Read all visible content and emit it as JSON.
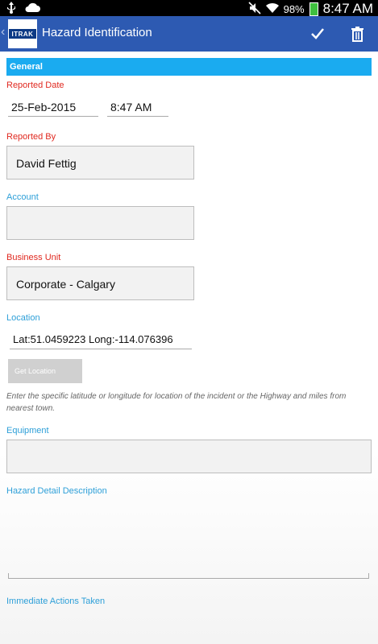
{
  "status_bar": {
    "battery": "98%",
    "time": "8:47 AM"
  },
  "action_bar": {
    "logo_text": "ITRAK",
    "title": "Hazard Identification"
  },
  "form": {
    "section_title": "General",
    "reported_date": {
      "label": "Reported Date",
      "date": "25-Feb-2015",
      "time": "8:47 AM"
    },
    "reported_by": {
      "label": "Reported By",
      "value": "David Fettig"
    },
    "account": {
      "label": "Account",
      "value": ""
    },
    "business_unit": {
      "label": "Business Unit",
      "value": "Corporate - Calgary"
    },
    "location": {
      "label": "Location",
      "value": "Lat:51.0459223 Long:-114.076396",
      "button": "Get Location",
      "hint": "Enter the specific latitude or longitude for location of the incident or the Highway and miles from nearest town."
    },
    "equipment": {
      "label": "Equipment",
      "value": ""
    },
    "hazard_detail": {
      "label": "Hazard Detail Description",
      "value": ""
    },
    "immediate_actions": {
      "label": "Immediate Actions Taken"
    }
  },
  "colors": {
    "action_bar": "#2d5ab2",
    "section_header": "#1aabf0",
    "required_label": "#e0281f",
    "optional_label": "#2d9fd8"
  }
}
